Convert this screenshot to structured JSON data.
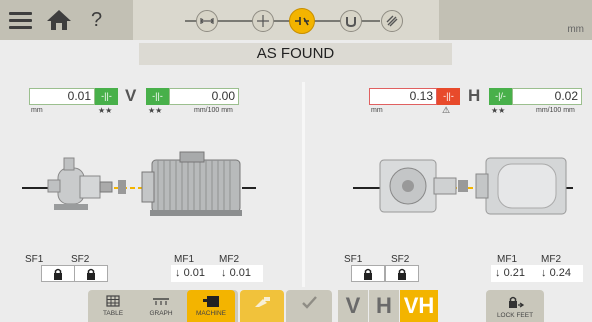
{
  "header": {
    "units": "mm",
    "steps": [
      {
        "name": "dimensions",
        "active": false
      },
      {
        "name": "measure-setup",
        "active": false
      },
      {
        "name": "results",
        "active": true
      },
      {
        "name": "shim",
        "active": false
      },
      {
        "name": "report",
        "active": false
      }
    ]
  },
  "title": "AS FOUND",
  "vertical": {
    "axis": "V",
    "offset_value": "0.01",
    "offset_unit": "mm",
    "angle_value": "0.00",
    "angle_unit": "mm/100 mm",
    "offset_stars": "★★",
    "angle_stars": "★★",
    "sf1_label": "SF1",
    "sf2_label": "SF2",
    "mf1_label": "MF1",
    "mf2_label": "MF2",
    "mf1_value": "0.01",
    "mf2_value": "0.01"
  },
  "horizontal": {
    "axis": "H",
    "offset_value": "0.13",
    "offset_unit": "mm",
    "angle_value": "0.02",
    "angle_unit": "mm/100 mm",
    "offset_warning": "⚠",
    "angle_stars": "★★",
    "sf1_label": "SF1",
    "sf2_label": "SF2",
    "mf1_label": "MF1",
    "mf2_label": "MF2",
    "mf1_value": "0.21",
    "mf2_value": "0.24"
  },
  "toolbar": {
    "table_label": "TABLE",
    "graph_label": "GRAPH",
    "machine_label": "MACHINE",
    "v_label": "V",
    "h_label": "H",
    "vh_label": "VH",
    "lockfeet_label": "LOCK FEET"
  },
  "colors": {
    "accent": "#f3b400",
    "good": "#48b04a",
    "bad": "#e84a2b"
  }
}
